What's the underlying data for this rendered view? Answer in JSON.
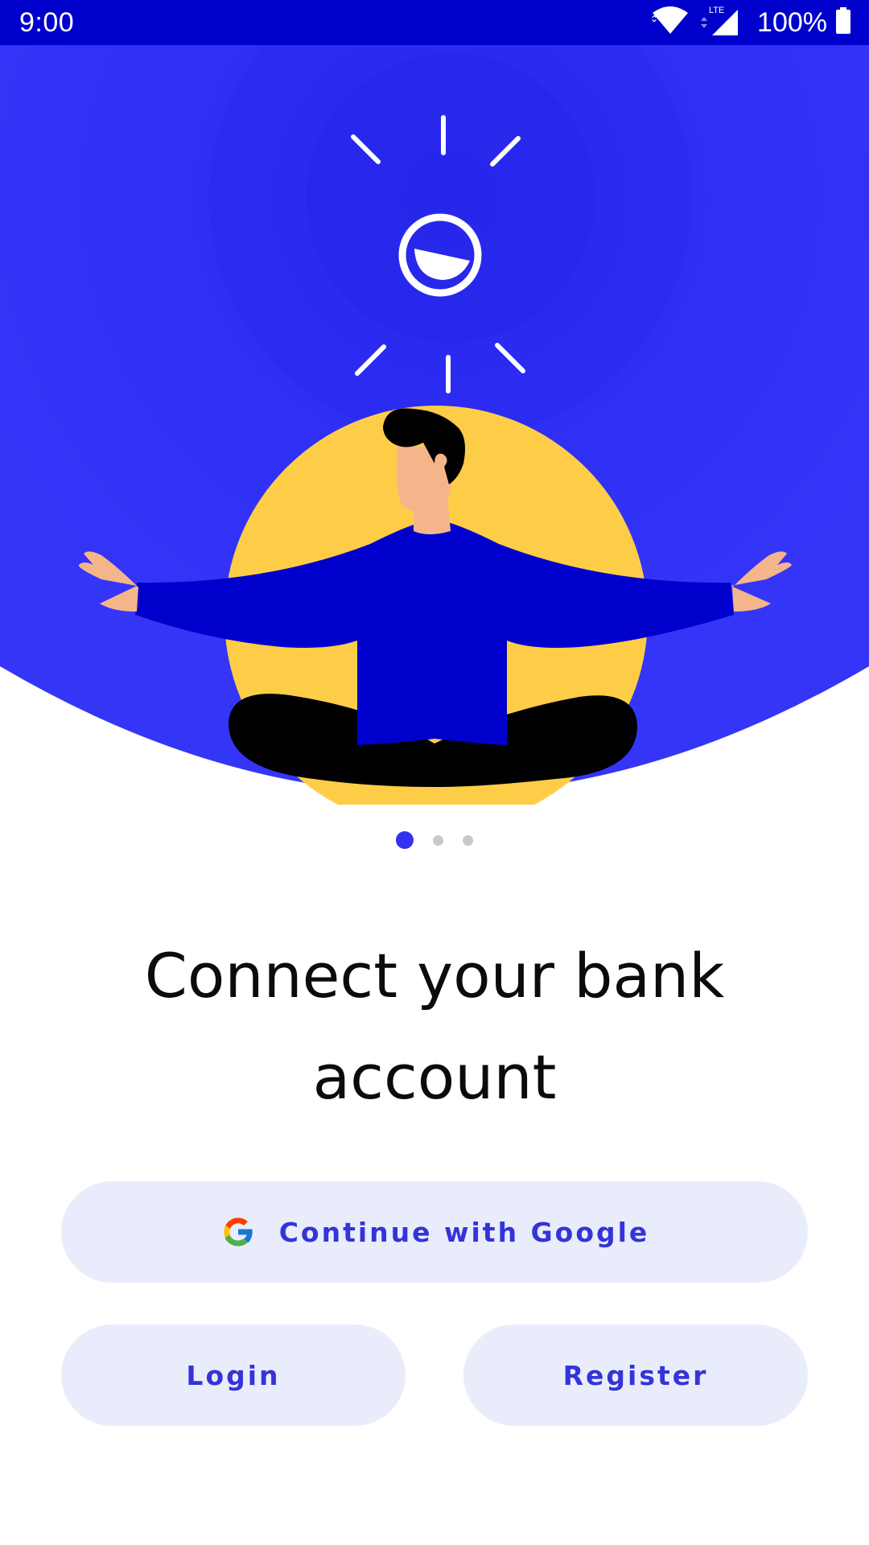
{
  "status_bar": {
    "time": "9:00",
    "network": "LTE",
    "battery": "100%"
  },
  "onboarding": {
    "headline": "Connect your bank account",
    "pager": {
      "count": 3,
      "active_index": 0
    },
    "illustration": "meditating-person-illustration"
  },
  "actions": {
    "google_label": "Continue with Google",
    "login_label": "Login",
    "register_label": "Register"
  },
  "colors": {
    "status_bar": "#0000cc",
    "hero_blue": "#2f2ff5",
    "accent": "#3434d8",
    "button_bg": "#e9edfb",
    "sun_yellow": "#fecd47"
  }
}
